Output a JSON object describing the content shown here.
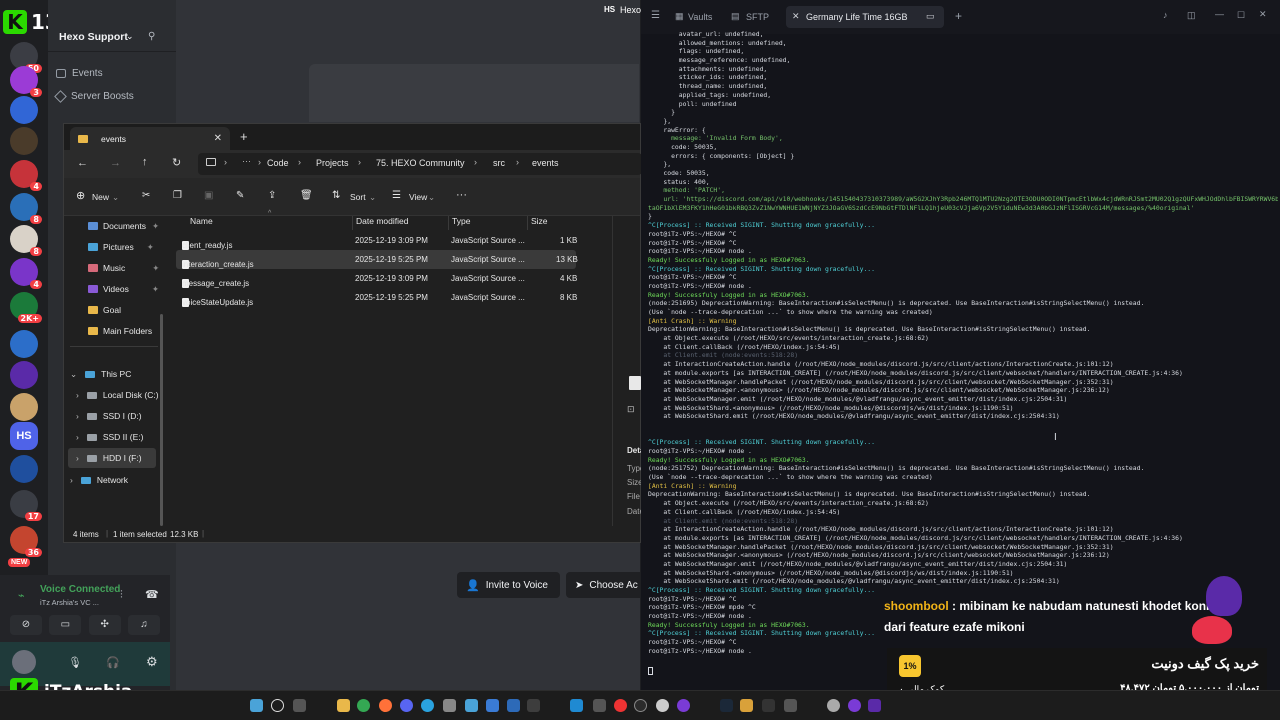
{
  "overlay": {
    "top_badge": "13",
    "streamer": "iTzArshia",
    "chat_user": "shoombool",
    "chat_message": "mibinam ke nabudam natunesti khodet koni dari feature ezafe mikoni",
    "donate_title": "خرید پک گیف دونیت",
    "donate_percent": "1%",
    "donate_amount_line": "۴۸,۴۷۲ تومان از ۵,۰۰۰,۰۰۰ تومان",
    "donate_count": "۰ کمک مالی"
  },
  "discord": {
    "server_name": "Hexo Support",
    "channels": [
      "Events",
      "Server Boosts"
    ],
    "top_label": "HS",
    "top_label2": "Hexo",
    "server_badges": [
      "50",
      "3",
      "4",
      "8",
      "8",
      "4",
      "2K+",
      "17",
      "36",
      "NEW"
    ],
    "server_icon_label": "HS",
    "voice_status": "Voice Connected",
    "voice_channel": "iTz Arshia's VC ...",
    "invite_button": "Invite to Voice",
    "choose_button": "Choose Ac"
  },
  "explorer": {
    "tab_title": "events",
    "breadcrumb": [
      "Code",
      "Projects",
      "75. HEXO Community",
      "src",
      "events"
    ],
    "commands": {
      "new": "New",
      "sort": "Sort",
      "view": "View"
    },
    "quick_access": [
      "Documents",
      "Pictures",
      "Music",
      "Videos",
      "Goal",
      "Main Folders"
    ],
    "tree": [
      {
        "label": "This PC"
      },
      {
        "label": "Local Disk (C:)"
      },
      {
        "label": "SSD I (D:)"
      },
      {
        "label": "SSD II (E:)"
      },
      {
        "label": "HDD I (F:)"
      },
      {
        "label": "Network"
      }
    ],
    "columns": [
      "Name",
      "Date modified",
      "Type",
      "Size"
    ],
    "files": [
      {
        "name": "client_ready.js",
        "date": "2025-12-19 3:09 PM",
        "type": "JavaScript Source ...",
        "size": "1 KB"
      },
      {
        "name": "interaction_create.js",
        "date": "2025-12-19 5:25 PM",
        "type": "JavaScript Source ...",
        "size": "13 KB"
      },
      {
        "name": "message_create.js",
        "date": "2025-12-19 3:09 PM",
        "type": "JavaScript Source ...",
        "size": "4 KB"
      },
      {
        "name": "voiceStateUpdate.js",
        "date": "2025-12-19 5:25 PM",
        "type": "JavaScript Source ...",
        "size": "8 KB"
      }
    ],
    "details_labels": [
      "Deta",
      "Type",
      "Size",
      "File",
      "Date"
    ],
    "status": {
      "items": "4 items",
      "selected": "1 item selected",
      "size": "12.3 KB"
    }
  },
  "terminal": {
    "tabs": [
      "Vaults",
      "SFTP",
      "Germany Life Time 16GB"
    ],
    "lines": [
      {
        "c": "w",
        "t": "        avatar_url: undefined,"
      },
      {
        "c": "w",
        "t": "        allowed_mentions: undefined,"
      },
      {
        "c": "w",
        "t": "        flags: undefined,"
      },
      {
        "c": "w",
        "t": "        message_reference: undefined,"
      },
      {
        "c": "w",
        "t": "        attachments: undefined,"
      },
      {
        "c": "w",
        "t": "        sticker_ids: undefined,"
      },
      {
        "c": "w",
        "t": "        thread_name: undefined,"
      },
      {
        "c": "w",
        "t": "        applied_tags: undefined,"
      },
      {
        "c": "w",
        "t": "        poll: undefined"
      },
      {
        "c": "w",
        "t": "      }"
      },
      {
        "c": "w",
        "t": "    },"
      },
      {
        "c": "w",
        "t": "    rawError: {"
      },
      {
        "c": "s",
        "t": "      message: 'Invalid Form Body',"
      },
      {
        "c": "w",
        "t": "      code: 50035,"
      },
      {
        "c": "w",
        "t": "      errors: { components: [Object] }"
      },
      {
        "c": "w",
        "t": "    },"
      },
      {
        "c": "w",
        "t": "    code: 50035,"
      },
      {
        "c": "w",
        "t": "    status: 400,"
      },
      {
        "c": "s",
        "t": "    method: 'PATCH',"
      },
      {
        "c": "s",
        "t": "    url: 'https://discord.com/api/v10/webhooks/1451540437310373989/aW5G2XJhY3Rpb246MTQ1MTU2Nzg2OTE3ODU0ODI0NTpmcEtlbWx4cjdWRnRJSmt2MU02Q1gzQUFxWHJOdDhlbFBISWRYRWV6b1Jl'"
      },
      {
        "c": "s",
        "t": "taOF1bXlEM3FKY1hHeG01bkRBQ3ZvZ1NwYWNHUE1WNjNYZ3JOaGV6SzdCcE9NbGtFTDlNFlLQ1hjeU03cVJja6Vp2V5Y1duNEw3d3A0bGJzNFlISGRVcG14M/messages/%40original'"
      },
      {
        "c": "w",
        "t": "}"
      },
      {
        "c": "c",
        "t": "^C[Process] :: Received SIGINT. Shutting down gracefully..."
      },
      {
        "c": "w",
        "t": "root@iTz-VPS:~/HEXO# ^C"
      },
      {
        "c": "w",
        "t": "root@iTz-VPS:~/HEXO# ^C"
      },
      {
        "c": "w",
        "t": "root@iTz-VPS:~/HEXO# node ."
      },
      {
        "c": "g",
        "t": "Ready! Successfuly Logged in as HEXO#7063."
      },
      {
        "c": "c",
        "t": "^C[Process] :: Received SIGINT. Shutting down gracefully..."
      },
      {
        "c": "w",
        "t": "root@iTz-VPS:~/HEXO# ^C"
      },
      {
        "c": "w",
        "t": "root@iTz-VPS:~/HEXO# node ."
      },
      {
        "c": "g",
        "t": "Ready! Successfuly Logged in as HEXO#7063."
      },
      {
        "c": "w",
        "t": "(node:251695) DeprecationWarning: BaseInteraction#isSelectMenu() is deprecated. Use BaseInteraction#isStringSelectMenu() instead."
      },
      {
        "c": "w",
        "t": "(Use `node --trace-deprecation ...` to show where the warning was created)"
      },
      {
        "c": "y",
        "t": "[Anti Crash] :: Warning"
      },
      {
        "c": "w",
        "t": "DeprecationWarning: BaseInteraction#isSelectMenu() is deprecated. Use BaseInteraction#isStringSelectMenu() instead."
      },
      {
        "c": "w",
        "t": "    at Object.execute (/root/HEXO/src/events/interaction_create.js:68:62)"
      },
      {
        "c": "w",
        "t": "    at Client.callBack (/root/HEXO/index.js:54:45)"
      },
      {
        "c": "d",
        "t": "    at Client.emit (node:events:518:28)"
      },
      {
        "c": "w",
        "t": "    at InteractionCreateAction.handle (/root/HEXO/node_modules/discord.js/src/client/actions/InteractionCreate.js:101:12)"
      },
      {
        "c": "w",
        "t": "    at module.exports [as INTERACTION_CREATE] (/root/HEXO/node_modules/discord.js/src/client/websocket/handlers/INTERACTION_CREATE.js:4:36)"
      },
      {
        "c": "w",
        "t": "    at WebSocketManager.handlePacket (/root/HEXO/node_modules/discord.js/src/client/websocket/WebSocketManager.js:352:31)"
      },
      {
        "c": "w",
        "t": "    at WebSocketManager.<anonymous> (/root/HEXO/node_modules/discord.js/src/client/websocket/WebSocketManager.js:236:12)"
      },
      {
        "c": "w",
        "t": "    at WebSocketManager.emit (/root/HEXO/node_modules/@vladfrangu/async_event_emitter/dist/index.cjs:2504:31)"
      },
      {
        "c": "w",
        "t": "    at WebSocketShard.<anonymous> (/root/HEXO/node_modules/@discordjs/ws/dist/index.js:1190:51)"
      },
      {
        "c": "w",
        "t": "    at WebSocketShard.emit (/root/HEXO/node_modules/@vladfrangu/async_event_emitter/dist/index.cjs:2504:31)"
      },
      {
        "c": "w",
        "t": ""
      },
      {
        "c": "w",
        "t": ""
      },
      {
        "c": "c",
        "t": "^C[Process] :: Received SIGINT. Shutting down gracefully..."
      },
      {
        "c": "w",
        "t": "root@iTz-VPS:~/HEXO# node ."
      },
      {
        "c": "g",
        "t": "Ready! Successfuly Logged in as HEXO#7063."
      },
      {
        "c": "w",
        "t": "(node:251752) DeprecationWarning: BaseInteraction#isSelectMenu() is deprecated. Use BaseInteraction#isStringSelectMenu() instead."
      },
      {
        "c": "w",
        "t": "(Use `node --trace-deprecation ...` to show where the warning was created)"
      },
      {
        "c": "y",
        "t": "[Anti Crash] :: Warning"
      },
      {
        "c": "w",
        "t": "DeprecationWarning: BaseInteraction#isSelectMenu() is deprecated. Use BaseInteraction#isStringSelectMenu() instead."
      },
      {
        "c": "w",
        "t": "    at Object.execute (/root/HEXO/src/events/interaction_create.js:68:62)"
      },
      {
        "c": "w",
        "t": "    at Client.callBack (/root/HEXO/index.js:54:45)"
      },
      {
        "c": "d",
        "t": "    at Client.emit (node:events:518:28)"
      },
      {
        "c": "w",
        "t": "    at InteractionCreateAction.handle (/root/HEXO/node_modules/discord.js/src/client/actions/InteractionCreate.js:101:12)"
      },
      {
        "c": "w",
        "t": "    at module.exports [as INTERACTION_CREATE] (/root/HEXO/node_modules/discord.js/src/client/websocket/handlers/INTERACTION_CREATE.js:4:36)"
      },
      {
        "c": "w",
        "t": "    at WebSocketManager.handlePacket (/root/HEXO/node_modules/discord.js/src/client/websocket/WebSocketManager.js:352:31)"
      },
      {
        "c": "w",
        "t": "    at WebSocketManager.<anonymous> (/root/HEXO/node_modules/discord.js/src/client/websocket/WebSocketManager.js:236:12)"
      },
      {
        "c": "w",
        "t": "    at WebSocketManager.emit (/root/HEXO/node_modules/@vladfrangu/async_event_emitter/dist/index.cjs:2504:31)"
      },
      {
        "c": "w",
        "t": "    at WebSocketShard.<anonymous> (/root/HEXO/node_modules/@discordjs/ws/dist/index.js:1190:51)"
      },
      {
        "c": "w",
        "t": "    at WebSocketShard.emit (/root/HEXO/node_modules/@vladfrangu/async_event_emitter/dist/index.cjs:2504:31)"
      },
      {
        "c": "c",
        "t": "^C[Process] :: Received SIGINT. Shutting down gracefully..."
      },
      {
        "c": "w",
        "t": "root@iTz-VPS:~/HEXO# ^C"
      },
      {
        "c": "w",
        "t": "root@iTz-VPS:~/HEXO# mpde ^C"
      },
      {
        "c": "w",
        "t": "root@iTz-VPS:~/HEXO# node ."
      },
      {
        "c": "g",
        "t": "Ready! Successfuly Logged in as HEXO#7063."
      },
      {
        "c": "c",
        "t": "^C[Process] :: Received SIGINT. Shutting down gracefully..."
      },
      {
        "c": "w",
        "t": "root@iTz-VPS:~/HEXO# ^C"
      },
      {
        "c": "w",
        "t": "root@iTz-VPS:~/HEXO# node ."
      }
    ]
  },
  "colors": {
    "terminal_bg": "#13141a",
    "cyan": "#4fd0d6",
    "green": "#6fdc5a",
    "yellow": "#e2c044",
    "brand_green": "#2bd900",
    "chat_user": "#f2b418",
    "donate_bar": "#f7c62f"
  }
}
